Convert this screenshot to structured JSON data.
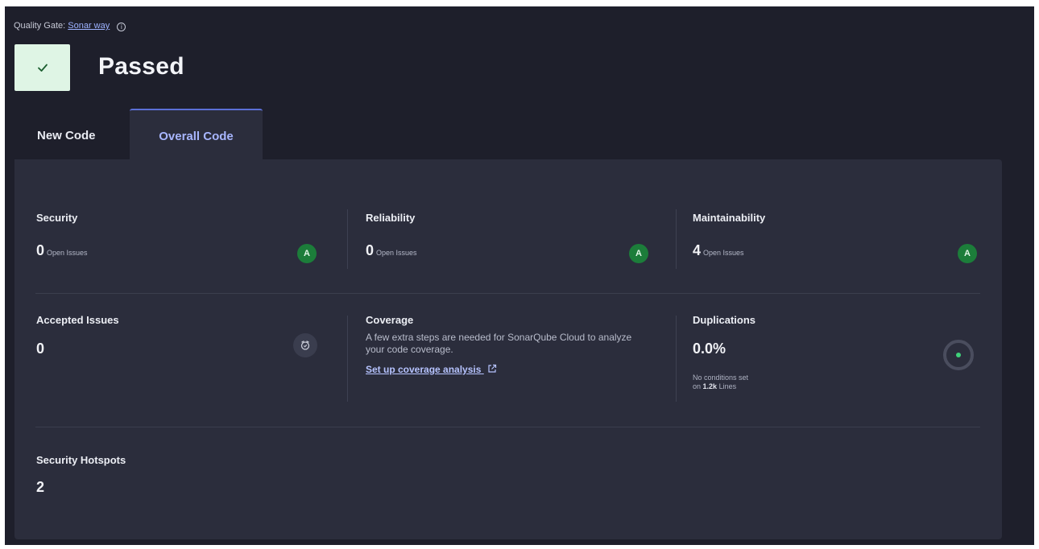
{
  "quality_gate": {
    "prefix": "Quality Gate:",
    "link": "Sonar way",
    "status": "Passed"
  },
  "tabs": [
    {
      "label": "New Code"
    },
    {
      "label": "Overall Code"
    }
  ],
  "metrics": {
    "security": {
      "title": "Security",
      "value": "0",
      "unit": "Open Issues",
      "grade": "A"
    },
    "reliability": {
      "title": "Reliability",
      "value": "0",
      "unit": "Open Issues",
      "grade": "A"
    },
    "maintainability": {
      "title": "Maintainability",
      "value": "4",
      "unit": "Open Issues",
      "grade": "A"
    },
    "accepted": {
      "title": "Accepted Issues",
      "value": "0"
    },
    "coverage": {
      "title": "Coverage",
      "text": "A few extra steps are needed for SonarQube Cloud to analyze your code coverage.",
      "link": "Set up coverage analysis"
    },
    "duplications": {
      "title": "Duplications",
      "value": "0.0%",
      "note_line1": "No conditions set",
      "note_prefix": "on",
      "note_lines": "1.2k",
      "note_suffix": "Lines"
    },
    "hotspots": {
      "title": "Security Hotspots",
      "value": "2"
    }
  },
  "colors": {
    "background": "#1e1f2b",
    "panel": "#2b2d3c",
    "grade_a": "#1c7d3a",
    "passed_box": "#dff5e5",
    "active_tab": "#a8b6ff"
  },
  "icons": [
    "info-icon",
    "check-icon",
    "accepted-issues-icon",
    "external-link-icon",
    "duplications-indicator-icon"
  ]
}
